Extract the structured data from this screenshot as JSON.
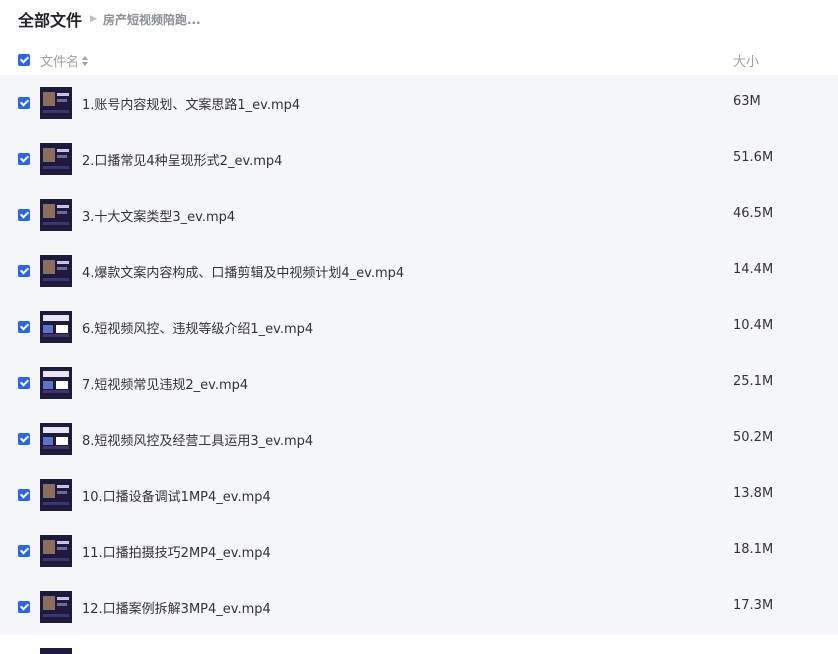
{
  "breadcrumb": {
    "root": "全部文件",
    "current": "房产短视频陪跑..."
  },
  "header": {
    "name_label": "文件名",
    "size_label": "大小"
  },
  "files": [
    {
      "name": "1.账号内容规划、文案思路1_ev.mp4",
      "size": "63M"
    },
    {
      "name": "2.口播常见4种呈现形式2_ev.mp4",
      "size": "51.6M"
    },
    {
      "name": "3.十大文案类型3_ev.mp4",
      "size": "46.5M"
    },
    {
      "name": "4.爆款文案内容构成、口播剪辑及中视频计划4_ev.mp4",
      "size": "14.4M"
    },
    {
      "name": "6.短视频风控、违规等级介绍1_ev.mp4",
      "size": "10.4M"
    },
    {
      "name": "7.短视频常见违规2_ev.mp4",
      "size": "25.1M"
    },
    {
      "name": "8.短视频风控及经营工具运用3_ev.mp4",
      "size": "50.2M"
    },
    {
      "name": "10.口播设备调试1MP4_ev.mp4",
      "size": "13.8M"
    },
    {
      "name": "11.口播拍摄技巧2MP4_ev.mp4",
      "size": "18.1M"
    },
    {
      "name": "12.口播案例拆解3MP4_ev.mp4",
      "size": "17.3M"
    }
  ],
  "colors": {
    "accent": "#2b63f0",
    "row_bg": "#f5f6fa",
    "thumb_bg": "#1e1a3d"
  }
}
